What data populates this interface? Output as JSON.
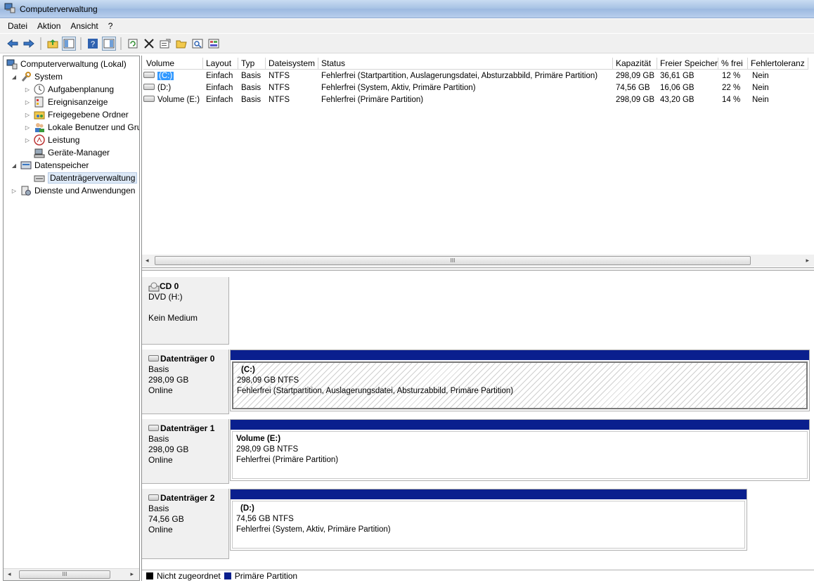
{
  "window": {
    "title": "Computerverwaltung"
  },
  "menu": {
    "items": [
      "Datei",
      "Aktion",
      "Ansicht",
      "?"
    ]
  },
  "toolbar": {
    "buttons": [
      "back-arrow-icon",
      "forward-arrow-icon",
      "up-folder-icon",
      "show-hide-tree-icon",
      "help-icon",
      "action-pane-icon",
      "refresh-icon",
      "delete-icon",
      "properties-icon",
      "open-folder-icon",
      "search-icon",
      "export-icon"
    ]
  },
  "tree": {
    "items": [
      {
        "label": "Computerverwaltung (Lokal)",
        "icon": "computer-management-icon"
      },
      {
        "label": "System",
        "icon": "tools-icon"
      },
      {
        "label": "Aufgabenplanung",
        "icon": "clock-icon"
      },
      {
        "label": "Ereignisanzeige",
        "icon": "event-log-icon"
      },
      {
        "label": "Freigegebene Ordner",
        "icon": "shared-folder-icon"
      },
      {
        "label": "Lokale Benutzer und Gruppen",
        "icon": "users-icon"
      },
      {
        "label": "Leistung",
        "icon": "performance-icon"
      },
      {
        "label": "Geräte-Manager",
        "icon": "device-manager-icon"
      },
      {
        "label": "Datenspeicher",
        "icon": "storage-icon"
      },
      {
        "label": "Datenträgerverwaltung",
        "icon": "disk-management-icon"
      },
      {
        "label": "Dienste und Anwendungen",
        "icon": "services-icon"
      }
    ]
  },
  "volume_list": {
    "columns": [
      "Volume",
      "Layout",
      "Typ",
      "Dateisystem",
      "Status",
      "Kapazität",
      "Freier Speicher",
      "% frei",
      "Fehlertoleranz"
    ],
    "rows": [
      [
        "(C:)",
        "Einfach",
        "Basis",
        "NTFS",
        "Fehlerfrei (Startpartition, Auslagerungsdatei, Absturzabbild, Primäre Partition)",
        "298,09 GB",
        "36,61 GB",
        "12 %",
        "Nein"
      ],
      [
        "(D:)",
        "Einfach",
        "Basis",
        "NTFS",
        "Fehlerfrei (System, Aktiv, Primäre Partition)",
        "74,56 GB",
        "16,06 GB",
        "22 %",
        "Nein"
      ],
      [
        "Volume (E:)",
        "Einfach",
        "Basis",
        "NTFS",
        "Fehlerfrei (Primäre Partition)",
        "298,09 GB",
        "43,20 GB",
        "14 %",
        "Nein"
      ]
    ],
    "scroll_grip": "III"
  },
  "disks": [
    {
      "name": "CD 0",
      "line1": "DVD (H:)",
      "line2": "",
      "line3": "Kein Medium",
      "partitions": []
    },
    {
      "name": "Datenträger 0",
      "line1": "Basis",
      "line2": "298,09 GB",
      "line3": "Online",
      "partitions": [
        {
          "title": "(C:)",
          "size": "298,09 GB NTFS",
          "status": "Fehlerfrei (Startpartition, Auslagerungsdatei, Absturzabbild, Primäre Partition)"
        }
      ]
    },
    {
      "name": "Datenträger 1",
      "line1": "Basis",
      "line2": "298,09 GB",
      "line3": "Online",
      "partitions": [
        {
          "title": "Volume  (E:)",
          "size": "298,09 GB NTFS",
          "status": "Fehlerfrei (Primäre Partition)"
        }
      ]
    },
    {
      "name": "Datenträger 2",
      "line1": "Basis",
      "line2": "74,56 GB",
      "line3": "Online",
      "partitions": [
        {
          "title": "(D:)",
          "size": "74,56 GB NTFS",
          "status": "Fehlerfrei (System, Aktiv, Primäre Partition)"
        }
      ]
    }
  ],
  "legend": {
    "items": [
      {
        "label": "Nicht zugeordnet",
        "color": "#000000"
      },
      {
        "label": "Primäre Partition",
        "color": "#0a1f8e"
      }
    ]
  },
  "colors": {
    "primary_partition": "#0a1f8e",
    "selection": "#3399ff"
  }
}
